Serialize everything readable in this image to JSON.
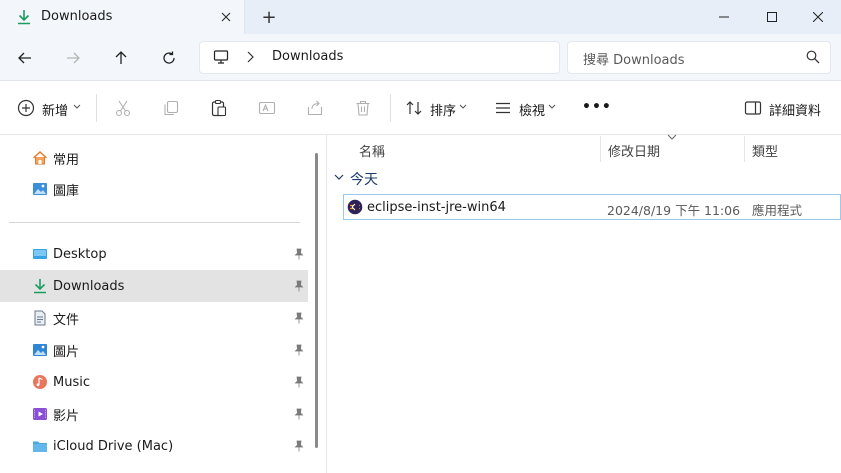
{
  "window": {
    "tab_title": "Downloads",
    "new_tab_symbol": "+",
    "min_symbol": "—",
    "max_symbol": "☐",
    "close_symbol": "✕"
  },
  "address": {
    "crumb": "Downloads",
    "search_placeholder": "搜尋 Downloads"
  },
  "toolbar": {
    "new_label": "新增",
    "sort_label": "排序",
    "view_label": "檢視",
    "more_label": "•••",
    "details_label": "詳細資料"
  },
  "sidebar": {
    "quick": [
      {
        "label": "常用",
        "icon": "home-icon"
      },
      {
        "label": "圖庫",
        "icon": "gallery-icon"
      }
    ],
    "pinned": [
      {
        "label": "Desktop",
        "icon": "desktop-icon",
        "selected": false
      },
      {
        "label": "Downloads",
        "icon": "download-icon",
        "selected": true
      },
      {
        "label": "文件",
        "icon": "documents-icon",
        "selected": false
      },
      {
        "label": "圖片",
        "icon": "pictures-icon",
        "selected": false
      },
      {
        "label": "Music",
        "icon": "music-icon",
        "selected": false
      },
      {
        "label": "影片",
        "icon": "videos-icon",
        "selected": false
      },
      {
        "label": "iCloud Drive (Mac)",
        "icon": "icloud-folder-icon",
        "selected": false
      }
    ]
  },
  "columns": {
    "name": "名稱",
    "date": "修改日期",
    "type": "類型"
  },
  "group": {
    "label": "今天"
  },
  "files": [
    {
      "name": "eclipse-inst-jre-win64",
      "modified": "2024/8/19 下午 11:06",
      "type": "應用程式"
    }
  ],
  "colors": {
    "accent_green": "#1a9e5f",
    "selection_border": "#99c9ef",
    "sidebar_selected": "#e3e3e3"
  }
}
